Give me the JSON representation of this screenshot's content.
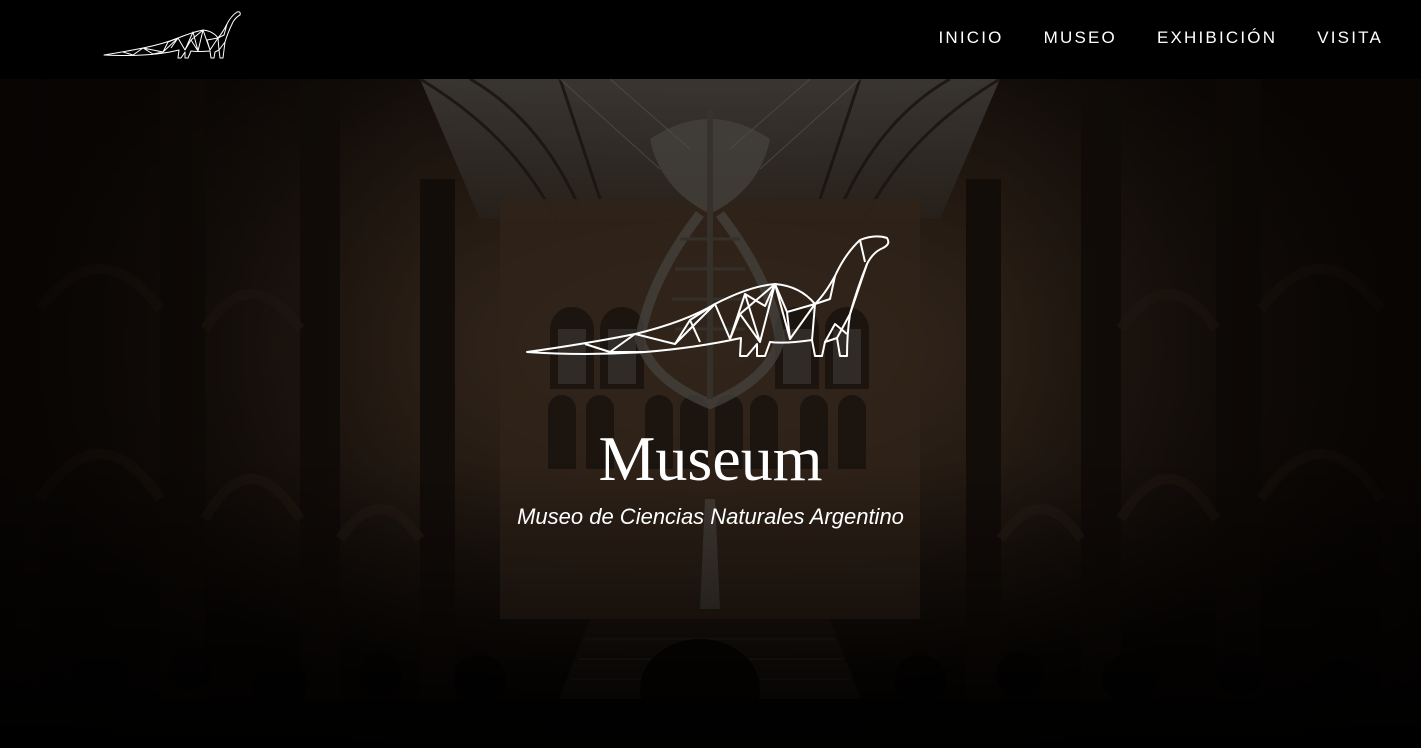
{
  "nav": {
    "logo_icon": "brachiosaurus-outline-icon",
    "links": [
      {
        "label": "INICIO"
      },
      {
        "label": "MUSEO"
      },
      {
        "label": "EXHIBICIÓN"
      },
      {
        "label": "VISITA"
      }
    ]
  },
  "hero": {
    "background": "dark museum hall photo",
    "emblem_icon": "brachiosaurus-outline-icon",
    "title": "Museum",
    "subtitle": "Museo de Ciencias Naturales Argentino"
  },
  "colors": {
    "nav_bg": "#000000",
    "text": "#ffffff",
    "hero_tone": "#2a1d14"
  }
}
